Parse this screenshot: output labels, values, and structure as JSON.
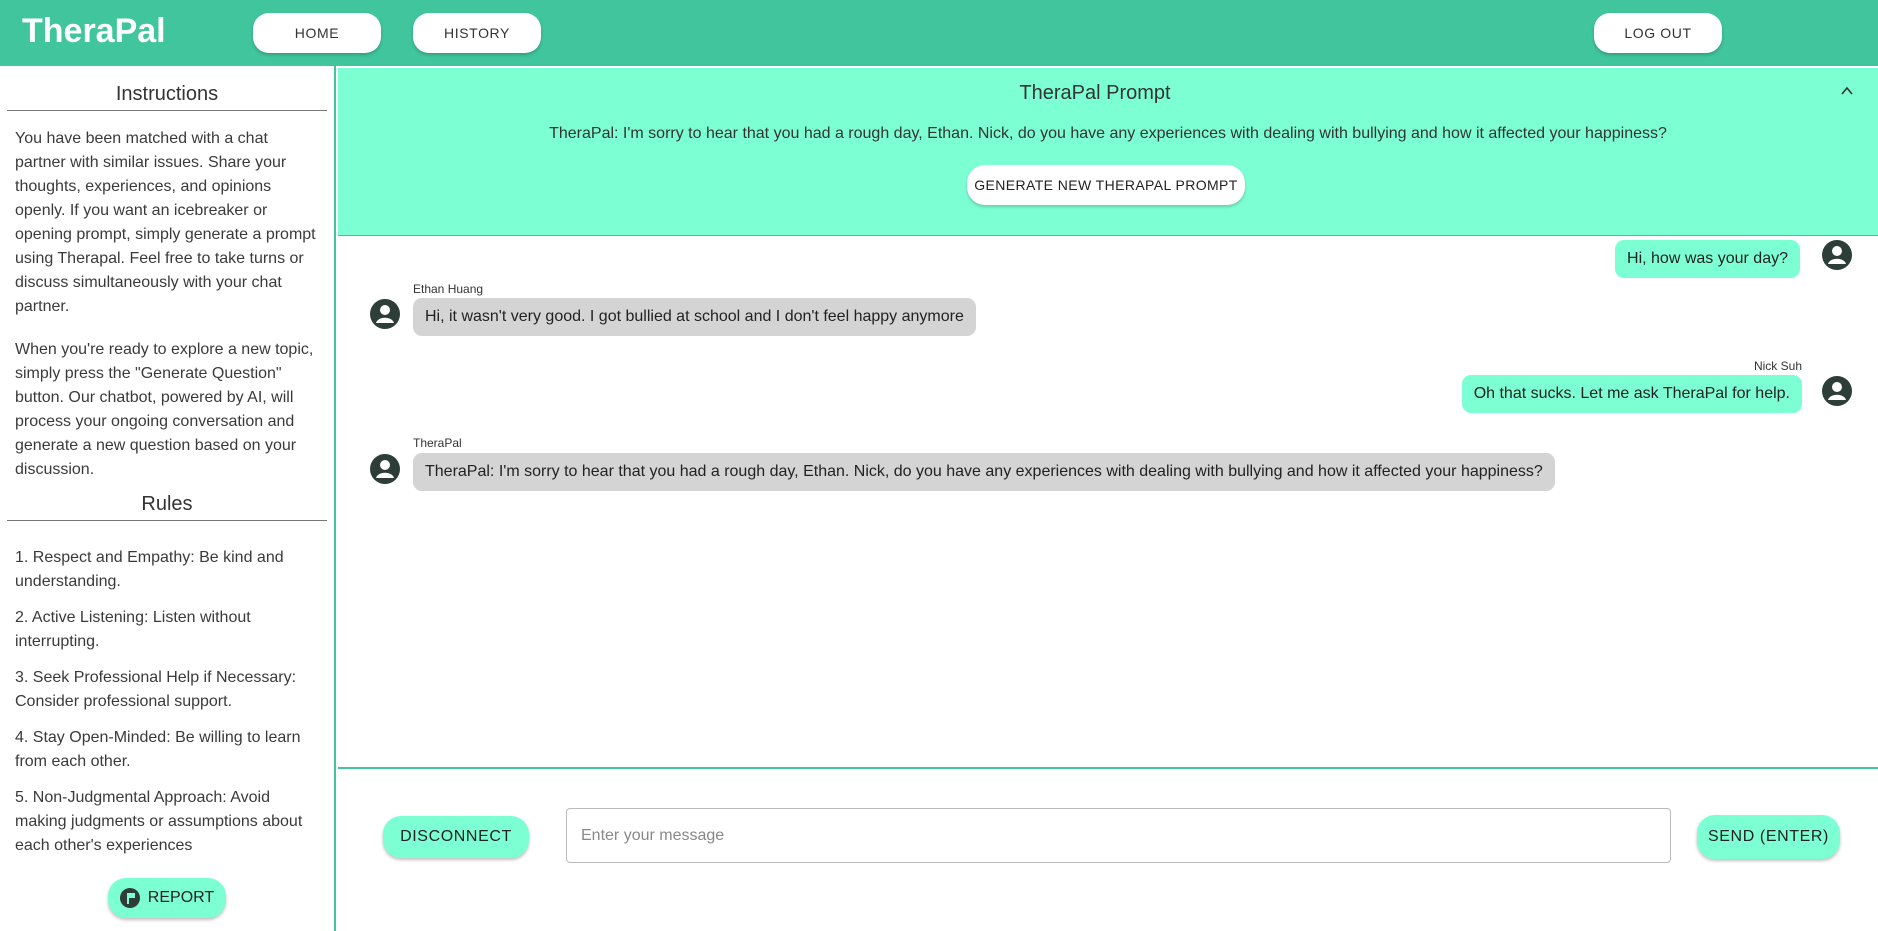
{
  "header": {
    "brand": "TheraPal",
    "nav": {
      "home": "HOME",
      "history": "HISTORY",
      "logout": "LOG OUT"
    }
  },
  "sidebar": {
    "instructions_heading": "Instructions",
    "instructions_p1": "You have been matched with a chat partner with similar issues. Share your thoughts, experiences, and opinions openly. If you want an icebreaker or opening prompt, simply generate a prompt using Therapal. Feel free to take turns or discuss simultaneously with your chat partner.",
    "instructions_p2": "When you're ready to explore a new topic, simply press the \"Generate Question\" button. Our chatbot, powered by AI, will process your ongoing conversation and generate a new question based on your discussion.",
    "rules_heading": "Rules",
    "rules": [
      "1. Respect and Empathy: Be kind and understanding.",
      "2. Active Listening: Listen without interrupting.",
      "3. Seek Professional Help if Necessary: Consider professional support.",
      "4. Stay Open-Minded: Be willing to learn from each other.",
      "5. Non-Judgmental Approach: Avoid making judgments or assumptions about each other's experiences"
    ],
    "report_label": "REPORT"
  },
  "prompt_panel": {
    "title": "TheraPal Prompt",
    "text": "TheraPal: I'm sorry to hear that you had a rough day, Ethan. Nick, do you have any experiences with dealing with bullying and how it affected your happiness?",
    "generate_label": "GENERATE NEW THERAPAL PROMPT"
  },
  "messages": [
    {
      "sender": "",
      "text": "Hi, how was your day?",
      "side": "right"
    },
    {
      "sender": "Ethan Huang",
      "text": "Hi, it wasn't very good. I got bullied at school and I don't feel happy anymore",
      "side": "left"
    },
    {
      "sender": "Nick Suh",
      "text": "Oh that sucks. Let me ask TheraPal for help.",
      "side": "right"
    },
    {
      "sender": "TheraPal",
      "text": "TheraPal: I'm sorry to hear that you had a rough day, Ethan. Nick, do you have any experiences with dealing with bullying and how it affected your happiness?",
      "side": "left"
    }
  ],
  "composer": {
    "disconnect_label": "DISCONNECT",
    "input_value": "",
    "input_placeholder": "Enter your message",
    "send_label": "SEND (ENTER)"
  },
  "colors": {
    "header": "#40c59c",
    "accent": "#7dffd4",
    "other_bubble": "#d4d4d4",
    "avatar": "#2d3d37"
  }
}
